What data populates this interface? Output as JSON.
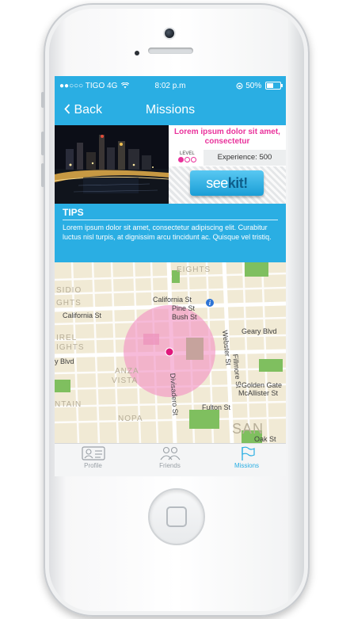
{
  "status_bar": {
    "carrier": "●●○○○ TIGO 4G",
    "time": "8:02 p.m",
    "battery": "50%",
    "battery_level": 0.5
  },
  "nav": {
    "back_label": "Back",
    "title": "Missions"
  },
  "mission": {
    "title": "Lorem ipsum dolor sit amet, consectetur",
    "level_label": "LEVEL",
    "level_dots_filled": 1,
    "level_dots_total": 3,
    "experience": "Experience: 500",
    "button_label_a": "see",
    "button_label_b": "kit!"
  },
  "tips": {
    "title": "TIPS",
    "body": "Lorem ipsum dolor sit amet, consectetur adipiscing elit. Curabitur luctus nisl turpis, at dignissim arcu tincidunt ac. Quisque vel tristiq."
  },
  "map": {
    "labels": {
      "heights_top": "EIGHTS",
      "sidio": "SIDIO",
      "ghts": "GHTS",
      "irel": "IREL",
      "ights": "IGHTS",
      "california_left": "California St",
      "california": "California St",
      "pine": "Pine St",
      "bush": "Bush St",
      "geary_blvd": "Geary Blvd",
      "geary_left": "y Blvd",
      "anza": "ANZA",
      "vista": "VISTA",
      "ntain": "NTAIN",
      "nopa": "NOPA",
      "divisadero": "Divisadero St",
      "webster": "Webster St",
      "fillmore": "Fillmore St",
      "golden_gate": "Golden Gate",
      "mcallister": "McAllister St",
      "fulton": "Fulton St",
      "oak": "Oak St",
      "san": "SAN"
    },
    "colors": {
      "land": "#f1ead5",
      "park": "#7fbf5f",
      "radius": "#f291c3",
      "pin": "#e0187c"
    }
  },
  "tabbar": {
    "tabs": [
      {
        "label": "Profile",
        "icon": "profile-card-icon",
        "active": false
      },
      {
        "label": "Friends",
        "icon": "friends-icon",
        "active": false
      },
      {
        "label": "Missions",
        "icon": "flag-icon",
        "active": true
      }
    ]
  }
}
